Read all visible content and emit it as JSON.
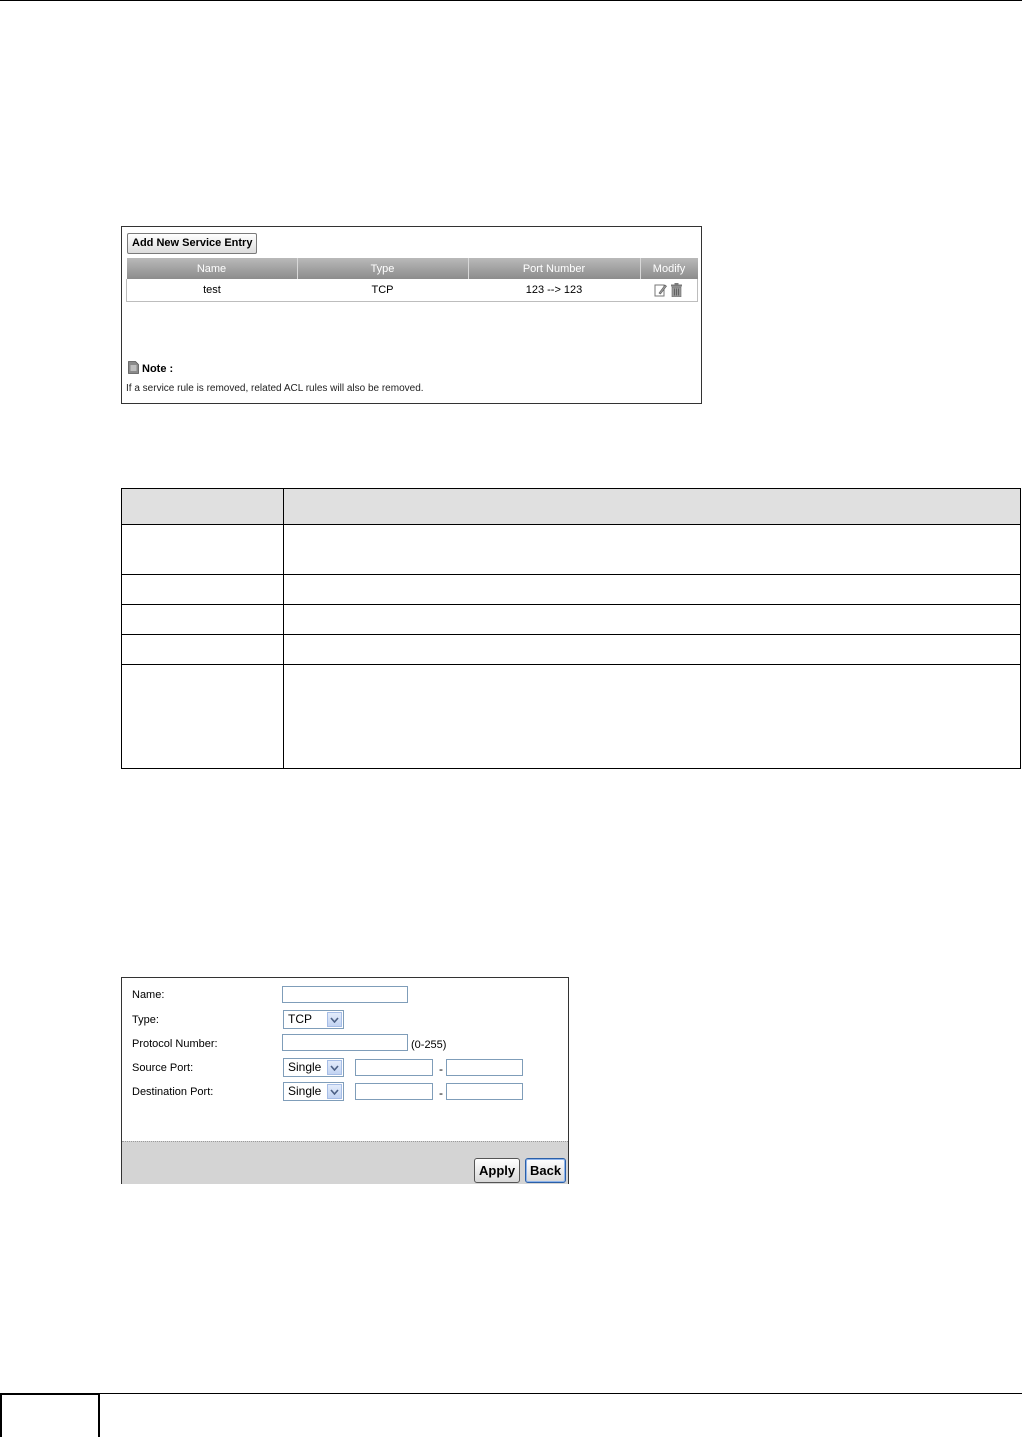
{
  "service_list": {
    "add_button_label": "Add New Service Entry",
    "columns": [
      "Name",
      "Type",
      "Port Number",
      "Modify"
    ],
    "rows": [
      {
        "name": "test",
        "type": "TCP",
        "port_number": "123 --> 123",
        "modify_icons": [
          "edit-icon",
          "delete-icon"
        ]
      }
    ],
    "note_label": "Note :",
    "note_text": "If a service rule is removed, related ACL rules will also be removed."
  },
  "add_form": {
    "name_label": "Name:",
    "name_value": "",
    "type_label": "Type:",
    "type_value": "TCP",
    "protocol_label": "Protocol Number:",
    "protocol_value": "",
    "protocol_hint": "(0-255)",
    "source_port_label": "Source Port:",
    "source_port_mode": "Single",
    "destination_port_label": "Destination Port:",
    "destination_port_mode": "Single",
    "range_separator": "-",
    "apply_label": "Apply",
    "back_label": "Back"
  },
  "colors": {
    "header_gradient_top": "#b9b9b9",
    "header_gradient_bottom": "#8c8c8c",
    "footer_bar": "#d4d4d4",
    "doc_table_header": "#e0e0e0"
  }
}
